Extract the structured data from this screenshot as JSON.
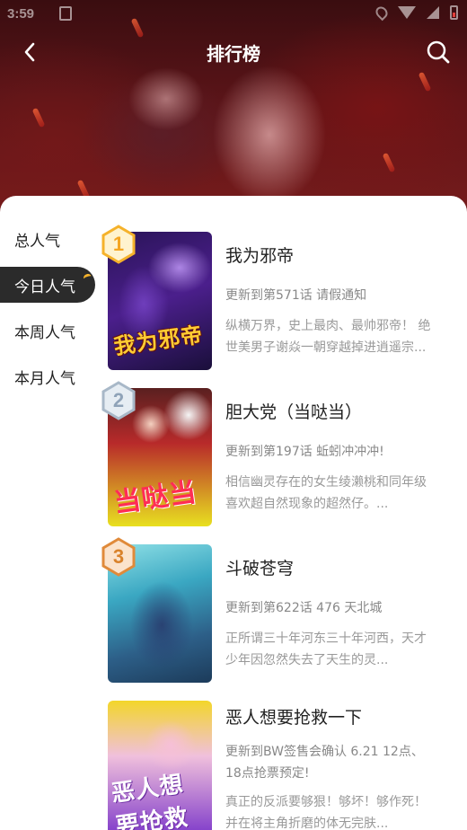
{
  "status_bar": {
    "time": "3:59"
  },
  "header": {
    "title": "排行榜"
  },
  "sidebar": {
    "items": [
      {
        "label": "总人气"
      },
      {
        "label": "今日人气"
      },
      {
        "label": "本周人气"
      },
      {
        "label": "本月人气"
      }
    ],
    "active_index": 1,
    "active_color": "#2b2b2b"
  },
  "ranking": {
    "items": [
      {
        "rank": "1",
        "rank_color": "#f5b22b",
        "cover_text": "我为邪帝",
        "name": "我为邪帝",
        "update": "更新到第571话 请假通知",
        "desc": "纵横万界，史上最肉、最帅邪帝！ 绝世美男子谢焱一朝穿越掉进逍遥宗..."
      },
      {
        "rank": "2",
        "rank_color": "#a8b8c8",
        "cover_text": "当哒当",
        "name": "胆大党（当哒当）",
        "update": "更新到第197话 蚯蚓冲冲冲!",
        "desc": "相信幽灵存在的女生绫濑桃和同年级喜欢超自然现象的超然仔。..."
      },
      {
        "rank": "3",
        "rank_color": "#e08a3a",
        "cover_text": "",
        "name": "斗破苍穹",
        "update": "更新到第622话 476 天北城",
        "desc": "正所谓三十年河东三十年河西，天才少年因忽然失去了天生的灵..."
      },
      {
        "rank": "",
        "rank_color": "",
        "cover_text": "恶人想要抢救",
        "name": "恶人想要抢救一下",
        "update": "更新到BW签售会确认 6.21 12点、18点抢票预定!",
        "desc": "真正的反派要够狠！够坏！够作死！并在将主角折磨的体无完肤..."
      }
    ]
  }
}
